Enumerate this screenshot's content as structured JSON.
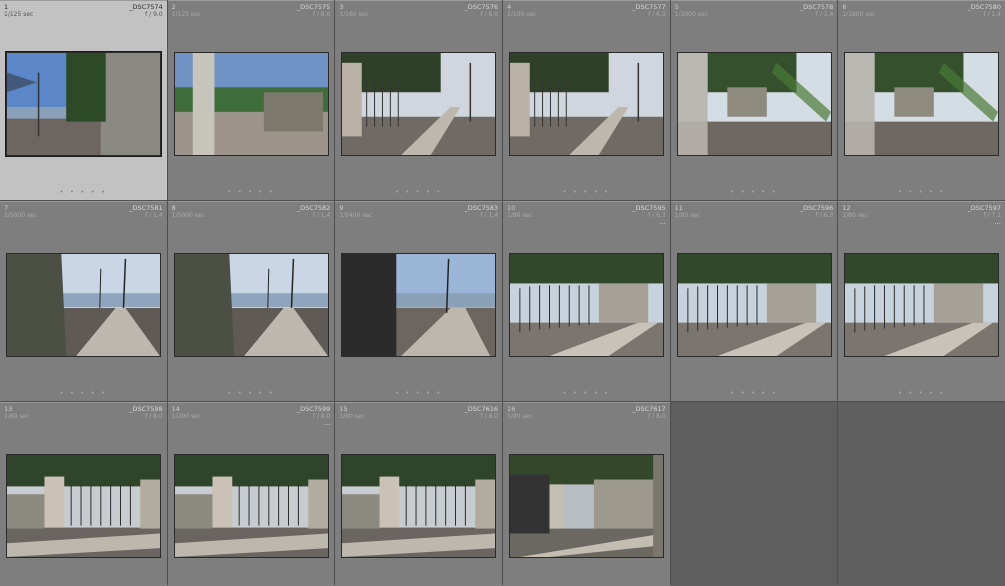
{
  "cells": [
    {
      "index": "1",
      "filename": "_DSC7574",
      "shutter": "1/125 sec",
      "aperture": "f / 9,0",
      "dots": "• • • • •",
      "selected": true,
      "scene": "lake"
    },
    {
      "index": "2",
      "filename": "_DSC7575",
      "shutter": "1/125 sec",
      "aperture": "f / 8,0",
      "dots": "• • • • •",
      "scene": "trunk"
    },
    {
      "index": "3",
      "filename": "_DSC7576",
      "shutter": "1/160 sec",
      "aperture": "f / 8,0",
      "dots": "• • • • •",
      "scene": "gate-road"
    },
    {
      "index": "4",
      "filename": "_DSC7577",
      "shutter": "1/100 sec",
      "aperture": "f / 6,3",
      "dots": "• • • • •",
      "scene": "gate-road"
    },
    {
      "index": "5",
      "filename": "_DSC7578",
      "shutter": "1/3000 sec",
      "aperture": "f / 1,4",
      "dots": "• • • • •",
      "scene": "blur"
    },
    {
      "index": "6",
      "filename": "_DSC7580",
      "shutter": "1/1600 sec",
      "aperture": "f / 1,4",
      "dots": "• • • • •",
      "scene": "blur"
    },
    {
      "index": "7",
      "filename": "_DSC7581",
      "shutter": "1/5000 sec",
      "aperture": "f / 1,4",
      "dots": "• • • • •",
      "scene": "promenade"
    },
    {
      "index": "8",
      "filename": "_DSC7582",
      "shutter": "1/5000 sec",
      "aperture": "f / 1,4",
      "dots": "• • • • •",
      "scene": "promenade"
    },
    {
      "index": "9",
      "filename": "_DSC7583",
      "shutter": "1/6400 sec",
      "aperture": "f / 1,4",
      "dots": "• • • • •",
      "scene": "dark-post"
    },
    {
      "index": "10",
      "filename": "_DSC7595",
      "shutter": "1/80 sec",
      "aperture": "f / 6,3",
      "dots": "• • • • •",
      "scene": "fence",
      "badge": "···"
    },
    {
      "index": "11",
      "filename": "_DSC7596",
      "shutter": "1/80 sec",
      "aperture": "f / 6,3",
      "dots": "• • • • •",
      "scene": "fence"
    },
    {
      "index": "12",
      "filename": "_DSC7597",
      "shutter": "1/80 sec",
      "aperture": "f / 7,1",
      "dots": "• • • • •",
      "scene": "fence",
      "badge": "···"
    },
    {
      "index": "13",
      "filename": "_DSC7598",
      "shutter": "1/80 sec",
      "aperture": "f / 8,0",
      "dots": "",
      "scene": "gate-front"
    },
    {
      "index": "14",
      "filename": "_DSC7599",
      "shutter": "1/200 sec",
      "aperture": "f / 8,0",
      "dots": "",
      "scene": "gate-front",
      "badge": "···"
    },
    {
      "index": "15",
      "filename": "_DSC7616",
      "shutter": "1/80 sec",
      "aperture": "f / 8,0",
      "dots": "",
      "scene": "gate-front"
    },
    {
      "index": "16",
      "filename": "_DSC7617",
      "shutter": "1/80 sec",
      "aperture": "f / 8,0",
      "dots": "",
      "scene": "gate-side"
    }
  ]
}
